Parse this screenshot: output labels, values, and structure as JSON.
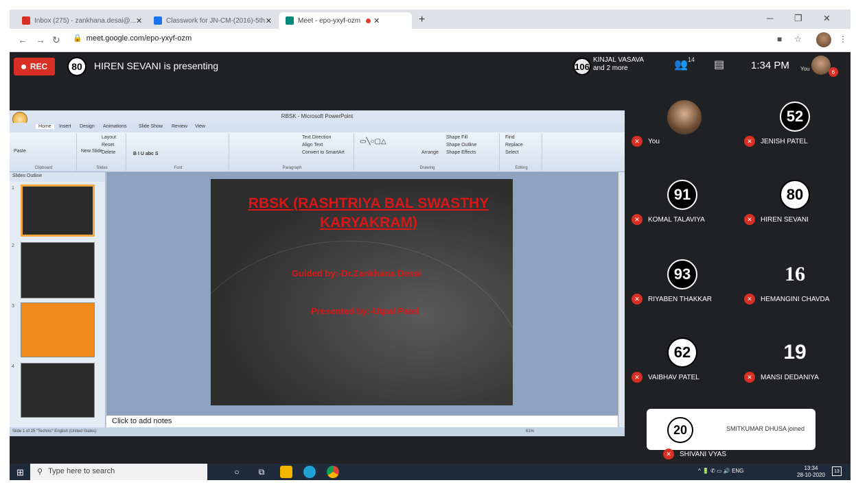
{
  "browser": {
    "tabs": [
      {
        "label": "Inbox (275) - zankhana.desai@...",
        "icon_color": "#d93025"
      },
      {
        "label": "Classwork for JN-CM-(2016)-5th",
        "icon_color": "#1a73e8"
      },
      {
        "label": "Meet - epo-yxyf-ozm",
        "icon_color": "#00897b"
      }
    ],
    "url": "meet.google.com/epo-yxyf-ozm",
    "new_tab": "+"
  },
  "meet": {
    "rec_label": "REC",
    "presenter_number": "80",
    "presenting_text": "HIREN SEVANI is presenting",
    "top_number": "106",
    "top_name_line1": "KINJAL VASAVA",
    "top_name_line2": "and 2 more",
    "people_count": "14",
    "time": "1:34 PM",
    "you_label": "You",
    "notif_count": "6",
    "participants": [
      {
        "name": "You",
        "avatar": "photo"
      },
      {
        "name": "JENISH PATEL",
        "avatar": "52"
      },
      {
        "name": "KOMAL TALAVIYA",
        "avatar": "91"
      },
      {
        "name": "HIREN SEVANI",
        "avatar": "80"
      },
      {
        "name": "RIYABEN THAKKAR",
        "avatar": "93"
      },
      {
        "name": "HEMANGINI CHAVDA",
        "avatar": "16"
      },
      {
        "name": "VAIBHAV PATEL",
        "avatar": "62"
      },
      {
        "name": "MANSI DEDANIYA",
        "avatar": "19"
      }
    ],
    "toast_number": "20",
    "toast_text": "SMITKUMAR DHUSA joined",
    "shivani": "SHIVANI VYAS"
  },
  "powerpoint": {
    "title": "RBSK - Microsoft PowerPoint",
    "tabs": [
      "Home",
      "Insert",
      "Design",
      "Animations",
      "Slide Show",
      "Review",
      "View"
    ],
    "groups": [
      "Clipboard",
      "Slides",
      "Font",
      "Paragraph",
      "Drawing",
      "Editing"
    ],
    "ribbon_items": {
      "layout": "Layout",
      "reset": "Reset",
      "delete": "Delete",
      "new_slide": "New Slide",
      "paste": "Paste",
      "find": "Find",
      "replace": "Replace",
      "select": "Select",
      "arrange": "Arrange",
      "quick_styles": "Quick Styles",
      "shape_fill": "Shape Fill",
      "shape_outline": "Shape Outline",
      "shape_effects": "Shape Effects",
      "text_direction": "Text Direction",
      "align_text": "Align Text",
      "smartart": "Convert to SmartArt"
    },
    "pane_tabs": "Slides  Outline",
    "slide_title": "RBSK (RASHTRIYA BAL SWASTHY KARYAKRAM)",
    "guided_by": "Guided by:-Dr.Zankhana Desai",
    "presented_by": "Presented by:-Utpal Patel",
    "notes": "Click to add notes",
    "status": "Slide 1 of 25   \"Technic\"   English (United States)",
    "zoom": "61%"
  },
  "taskbar": {
    "search": "Type here to search",
    "tray": "ENG",
    "time": "13:34",
    "date": "28-10-2020",
    "notify": "13"
  }
}
